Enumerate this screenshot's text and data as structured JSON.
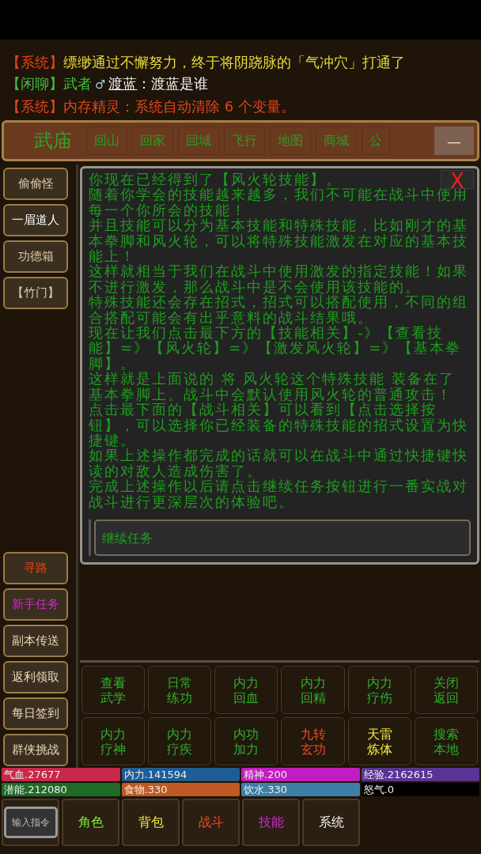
{
  "chat": [
    {
      "channel": "【系统】",
      "kind": "system",
      "message": "缥缈通过不懈努力，终于将阴跷脉的「气冲穴」打通了",
      "color": "#e6dc3c"
    },
    {
      "channel": "【闲聊】",
      "kind": "chat",
      "speaker": "武者",
      "gender": "♂",
      "name": "渡蓝",
      "message": "：渡蓝是谁"
    },
    {
      "channel": "【系统】",
      "kind": "system",
      "message": "内存精灵：系统自动清除 6 个变量。",
      "color": "#e2441c"
    }
  ],
  "location": {
    "place": "武庙",
    "actions": [
      "回山",
      "回家",
      "回城",
      "飞行",
      "地图",
      "商城",
      "公"
    ],
    "collapse": "—"
  },
  "npcs": [
    {
      "label": "偷偷怪",
      "selected": false
    },
    {
      "label": "一眉道人",
      "selected": true
    },
    {
      "label": "功德箱",
      "selected": false
    },
    {
      "label": "【竹门】",
      "selected": false
    }
  ],
  "quick_menu": [
    {
      "label": "寻路",
      "color": "#e2441c"
    },
    {
      "label": "新手任务",
      "color": "#d02ad0"
    },
    {
      "label": "副本传送",
      "color": "#e8d8b8"
    },
    {
      "label": "返利领取",
      "color": "#e8d8b8"
    },
    {
      "label": "每日签到",
      "color": "#e8d8b8"
    },
    {
      "label": "群侠挑战",
      "color": "#e8d8b8"
    }
  ],
  "dialog": {
    "close": "X",
    "paragraphs": [
      "你现在已经得到了【风火轮技能】。",
      "随着你学会的技能越来越多，我们不可能在战斗中使用每一个你所会的技能！",
      "并且技能可以分为基本技能和特殊技能，比如刚才的基本拳脚和风火轮，可以将特殊技能激发在对应的基本技能上！",
      "这样就相当于我们在战斗中使用激发的指定技能！如果不进行激发，那么战斗中是不会使用该技能的。",
      "特殊技能还会存在招式，招式可以搭配使用，不同的组合搭配可能会有出乎意料的战斗结果哦。",
      "现在让我们点击最下方的【技能相关】-》【查看技能】=》【风火轮】=》【激发风火轮】=》【基本拳脚】。",
      "这样就是上面说的 将 风火轮这个特殊技能 装备在了基本拳脚上。战斗中会默认使用风火轮的普通攻击！",
      "点击最下面的【战斗相关】可以看到【点击选择按钮】，可以选择你已经装备的特殊技能的招式设置为快捷键。",
      "如果上述操作都完成的话就可以在战斗中通过快捷键快读的对敌人造成伤害了。",
      "完成上述操作以后请点击继续任务按钮进行一番实战对战斗进行更深层次的体验吧。"
    ],
    "input": {
      "placeholder": "继续任务"
    }
  },
  "skills": [
    {
      "label": "查看武学",
      "color": "#2fae2f"
    },
    {
      "label": "日常练功",
      "color": "#2fae2f"
    },
    {
      "label": "内力回血",
      "color": "#2fae2f"
    },
    {
      "label": "内力回精",
      "color": "#2fae2f"
    },
    {
      "label": "内力疗伤",
      "color": "#2fae2f"
    },
    {
      "label": "关闭返回",
      "color": "#2fae2f"
    },
    {
      "label": "内力疗神",
      "color": "#2fae2f"
    },
    {
      "label": "内力疗疾",
      "color": "#2fae2f"
    },
    {
      "label": "内功加力",
      "color": "#2fae2f"
    },
    {
      "label": "九转玄功",
      "color": "#ee4a22"
    },
    {
      "label": "天雷炼体",
      "color": "#f2e63a"
    },
    {
      "label": "搜索本地",
      "color": "#2fae2f"
    }
  ],
  "stats": [
    {
      "label": "气血.27677",
      "color": "#c8284a"
    },
    {
      "label": "内力.141594",
      "color": "#1e5c94"
    },
    {
      "label": "精神.200",
      "color": "#c01ec0"
    },
    {
      "label": "经验.2162615",
      "color": "#5a3494"
    },
    {
      "label": "潜能.212080",
      "color": "#1e6a26"
    },
    {
      "label": "食物.330",
      "color": "#c05a22"
    },
    {
      "label": "饮水.330",
      "color": "#3f7fa6"
    },
    {
      "label": "怒气.0",
      "color": "#000000"
    }
  ],
  "nav": {
    "command": "输入指令",
    "tabs": [
      {
        "label": "角色",
        "color": "#7ee63a"
      },
      {
        "label": "背包",
        "color": "#f0e63a"
      },
      {
        "label": "战斗",
        "color": "#ee4a22"
      },
      {
        "label": "技能",
        "color": "#d22ad2"
      },
      {
        "label": "系统",
        "color": "#f0f0f0"
      }
    ]
  }
}
